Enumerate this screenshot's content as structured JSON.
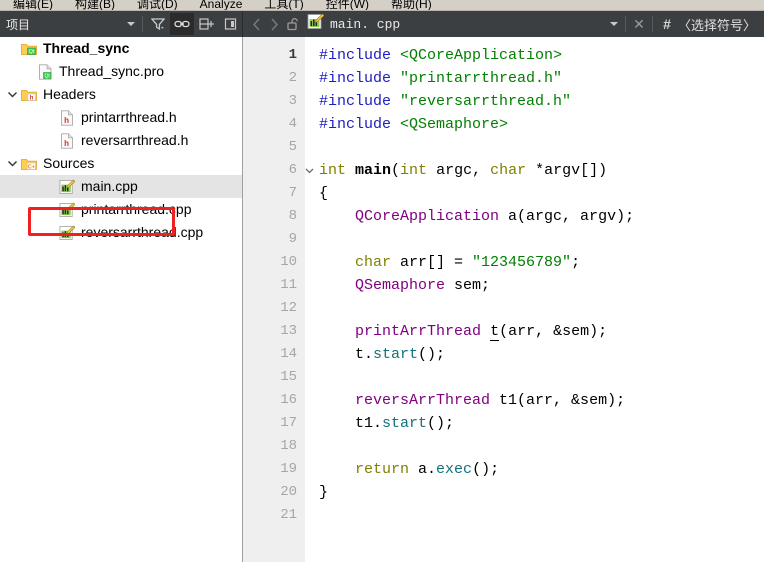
{
  "menubar": {
    "items": [
      {
        "label": "编辑(E)"
      },
      {
        "label": "构建(B)"
      },
      {
        "label": "调试(D)"
      },
      {
        "label": "Analyze"
      },
      {
        "label": "工具(T)"
      },
      {
        "label": "控件(W)"
      },
      {
        "label": "帮助(H)"
      }
    ]
  },
  "toolbar": {
    "project_combo_value": "项目",
    "filter_icon": "filter-icon",
    "link_icon": "link-with-editor-icon",
    "split_icon": "split-pane-icon",
    "close_pane_icon": "close-sidebar-icon",
    "nav_back_icon": "chevron-left-icon",
    "nav_forward_icon": "chevron-right-icon",
    "lock_icon": "unlocked-padlock-icon",
    "file_icon": "cpp-file-icon",
    "file_name": "main. cpp",
    "dropdown_icon": "chevron-down-icon",
    "close_icon": "close-x-icon",
    "hash_icon": "#",
    "symbol_selector": "〈选择符号〉"
  },
  "sidebar": {
    "tree": [
      {
        "label": "Thread_sync",
        "icon": "qt-project-folder-icon",
        "indent": 0,
        "arrow": "none",
        "bold": true,
        "selected": false
      },
      {
        "label": "Thread_sync.pro",
        "icon": "qt-pro-file-icon",
        "indent": 1,
        "arrow": "none",
        "bold": false,
        "selected": false
      },
      {
        "label": "Headers",
        "icon": "headers-folder-icon",
        "indent": 0,
        "arrow": "expanded",
        "bold": false,
        "selected": false
      },
      {
        "label": "printarrthread.h",
        "icon": "h-file-icon",
        "indent": 2,
        "arrow": "none",
        "bold": false,
        "selected": false
      },
      {
        "label": "reversarrthread.h",
        "icon": "h-file-icon",
        "indent": 2,
        "arrow": "none",
        "bold": false,
        "selected": false
      },
      {
        "label": "Sources",
        "icon": "sources-folder-icon",
        "indent": 0,
        "arrow": "expanded",
        "bold": false,
        "selected": false
      },
      {
        "label": "main.cpp",
        "icon": "cpp-file-icon",
        "indent": 2,
        "arrow": "none",
        "bold": false,
        "selected": true
      },
      {
        "label": "printarrthread.cpp",
        "icon": "cpp-file-icon",
        "indent": 2,
        "arrow": "none",
        "bold": false,
        "selected": false
      },
      {
        "label": "reversarrthread.cpp",
        "icon": "cpp-file-icon",
        "indent": 2,
        "arrow": "none",
        "bold": false,
        "selected": false
      }
    ],
    "annotation": {
      "color": "#ee2020",
      "target": "main.cpp"
    }
  },
  "editor": {
    "current_line": 1,
    "lines": [
      {
        "n": "1",
        "fold": false,
        "tokens": [
          {
            "t": "#include ",
            "c": "pre"
          },
          {
            "t": "<QCoreApplication>",
            "c": "str"
          }
        ]
      },
      {
        "n": "2",
        "fold": false,
        "tokens": [
          {
            "t": "#include ",
            "c": "pre"
          },
          {
            "t": "\"printarrthread.h\"",
            "c": "str"
          }
        ]
      },
      {
        "n": "3",
        "fold": false,
        "tokens": [
          {
            "t": "#include ",
            "c": "pre"
          },
          {
            "t": "\"reversarrthread.h\"",
            "c": "str"
          }
        ]
      },
      {
        "n": "4",
        "fold": false,
        "tokens": [
          {
            "t": "#include ",
            "c": "pre"
          },
          {
            "t": "<QSemaphore>",
            "c": "str"
          }
        ]
      },
      {
        "n": "5",
        "fold": false,
        "tokens": []
      },
      {
        "n": "6",
        "fold": true,
        "tokens": [
          {
            "t": "int ",
            "c": "kw"
          },
          {
            "t": "main",
            "c": "fn"
          },
          {
            "t": "(",
            "c": "plain"
          },
          {
            "t": "int",
            "c": "kw"
          },
          {
            "t": " argc, ",
            "c": "plain"
          },
          {
            "t": "char",
            "c": "kw"
          },
          {
            "t": " *argv[])",
            "c": "plain"
          }
        ]
      },
      {
        "n": "7",
        "fold": false,
        "tokens": [
          {
            "t": "{",
            "c": "plain"
          }
        ]
      },
      {
        "n": "8",
        "fold": false,
        "tokens": [
          {
            "t": "    ",
            "c": "plain"
          },
          {
            "t": "QCoreApplication",
            "c": "type"
          },
          {
            "t": " a(argc, argv);",
            "c": "plain"
          }
        ]
      },
      {
        "n": "9",
        "fold": false,
        "tokens": []
      },
      {
        "n": "10",
        "fold": false,
        "tokens": [
          {
            "t": "    ",
            "c": "plain"
          },
          {
            "t": "char",
            "c": "kw"
          },
          {
            "t": " arr[] = ",
            "c": "plain"
          },
          {
            "t": "\"123456789\"",
            "c": "str"
          },
          {
            "t": ";",
            "c": "plain"
          }
        ]
      },
      {
        "n": "11",
        "fold": false,
        "tokens": [
          {
            "t": "    ",
            "c": "plain"
          },
          {
            "t": "QSemaphore",
            "c": "type"
          },
          {
            "t": " sem;",
            "c": "plain"
          }
        ]
      },
      {
        "n": "12",
        "fold": false,
        "tokens": []
      },
      {
        "n": "13",
        "fold": false,
        "tokens": [
          {
            "t": "    ",
            "c": "plain"
          },
          {
            "t": "printArrThread",
            "c": "type"
          },
          {
            "t": " ",
            "c": "plain"
          },
          {
            "t": "t",
            "c": "unused"
          },
          {
            "t": "(arr, &sem);",
            "c": "plain"
          }
        ]
      },
      {
        "n": "14",
        "fold": false,
        "tokens": [
          {
            "t": "    t.",
            "c": "plain"
          },
          {
            "t": "start",
            "c": "meth"
          },
          {
            "t": "();",
            "c": "plain"
          }
        ]
      },
      {
        "n": "15",
        "fold": false,
        "tokens": []
      },
      {
        "n": "16",
        "fold": false,
        "tokens": [
          {
            "t": "    ",
            "c": "plain"
          },
          {
            "t": "reversArrThread",
            "c": "type"
          },
          {
            "t": " t1(arr, &sem);",
            "c": "plain"
          }
        ]
      },
      {
        "n": "17",
        "fold": false,
        "tokens": [
          {
            "t": "    t1.",
            "c": "plain"
          },
          {
            "t": "start",
            "c": "meth"
          },
          {
            "t": "();",
            "c": "plain"
          }
        ]
      },
      {
        "n": "18",
        "fold": false,
        "tokens": []
      },
      {
        "n": "19",
        "fold": false,
        "tokens": [
          {
            "t": "    ",
            "c": "plain"
          },
          {
            "t": "return",
            "c": "kw"
          },
          {
            "t": " a.",
            "c": "plain"
          },
          {
            "t": "exec",
            "c": "meth"
          },
          {
            "t": "();",
            "c": "plain"
          }
        ]
      },
      {
        "n": "20",
        "fold": false,
        "tokens": [
          {
            "t": "}",
            "c": "plain"
          }
        ]
      },
      {
        "n": "21",
        "fold": false,
        "tokens": []
      }
    ]
  },
  "colors": {
    "toolbar_bg": "#3c3f41",
    "menubar_bg": "#d4d0c8",
    "gutter_bg": "#efefef",
    "selection_bg": "#e4e4e4",
    "annotation_red": "#ee2020",
    "preprocessor": "#2020c0",
    "string": "#008000",
    "keyword": "#808000",
    "qt_type": "#800080",
    "method": "#11737a"
  }
}
